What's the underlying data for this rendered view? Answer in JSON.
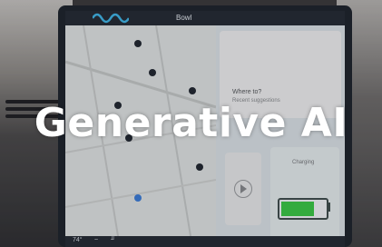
{
  "overlay": {
    "title": "Generative AI"
  },
  "screen": {
    "topbar_title": "Bowl",
    "where_to": "Where to?",
    "where_sub": "Recent suggestions",
    "charge_label": "Charging",
    "battery_level": 0.75,
    "bottombar": {
      "temp": "74°",
      "fan": "~",
      "seat": "╜"
    }
  },
  "colors": {
    "accent_wave": "#3fb6e6",
    "battery": "#39c93f"
  },
  "icons": [
    "voice-assistant-wave-icon",
    "play-icon",
    "battery-icon",
    "map-pin-icon"
  ]
}
